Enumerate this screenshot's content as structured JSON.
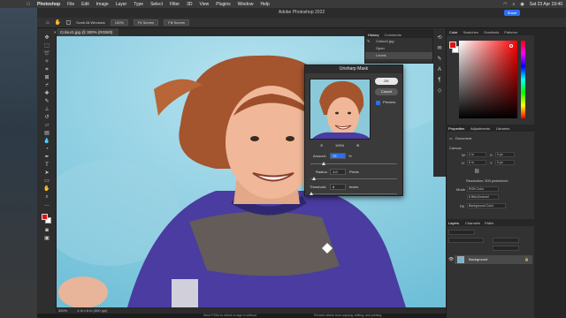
{
  "menubar": {
    "app": "Photoshop",
    "items": [
      "File",
      "Edit",
      "Image",
      "Layer",
      "Type",
      "Select",
      "Filter",
      "3D",
      "View",
      "Plugins",
      "Window",
      "Help"
    ],
    "clock": "Sat 23 Apr  19:40"
  },
  "window": {
    "title": "Adobe Photoshop 2022",
    "share_label": "Share"
  },
  "options": {
    "scroll_all_label": "Scroll All Windows",
    "zoom_btn": "100%",
    "fit_btn": "Fit Screen",
    "fill_btn": "Fill Screen"
  },
  "document": {
    "tab_label": "Colour1.jpg @ 300% (RGB/8)",
    "status_zoom": "300%",
    "status_info": "4 in x 6 in (300 ppi)"
  },
  "bottom_hints": {
    "left": "Send PSDs to others to sign in without",
    "right": "Prevent others from copying, editing, and printing."
  },
  "history": {
    "tabs": [
      "History",
      "Comments"
    ],
    "items": [
      "Colour1.jpg",
      "Open",
      "Levels"
    ]
  },
  "color_panel": {
    "tabs": [
      "Color",
      "Swatches",
      "Gradients",
      "Patterns"
    ],
    "fg_color": "#e01010",
    "bg_color": "#ffffff"
  },
  "properties": {
    "tabs": [
      "Properties",
      "Adjustments",
      "Libraries"
    ],
    "document_label": "Document",
    "canvas_label": "Canvas",
    "w_label": "W",
    "w_value": "4 in",
    "h_label": "H",
    "h_value": "6 in",
    "x_label": "X",
    "x_value": "0 px",
    "y_label": "Y",
    "y_value": "0 px",
    "resolution": "Resolution: 300 pixels/inch",
    "mode_label": "Mode",
    "mode_value": "RGB Color",
    "depth_value": "8 Bits/Channel",
    "fill_label": "Fill",
    "fill_value": "Background Color"
  },
  "layers": {
    "tabs": [
      "Layers",
      "Channels",
      "Paths"
    ],
    "layer_name": "Background"
  },
  "dialog": {
    "title": "Unsharp Mask",
    "ok": "OK",
    "cancel": "Cancel",
    "preview_label": "Preview",
    "zoom_value": "100%",
    "amount_label": "Amount:",
    "amount_value": "75",
    "amount_unit": "%",
    "amount_level": 0.15,
    "radius_label": "Radius:",
    "radius_value": "1.0",
    "radius_unit": "Pixels",
    "threshold_label": "Threshold:",
    "threshold_value": "0",
    "threshold_unit": "levels"
  }
}
